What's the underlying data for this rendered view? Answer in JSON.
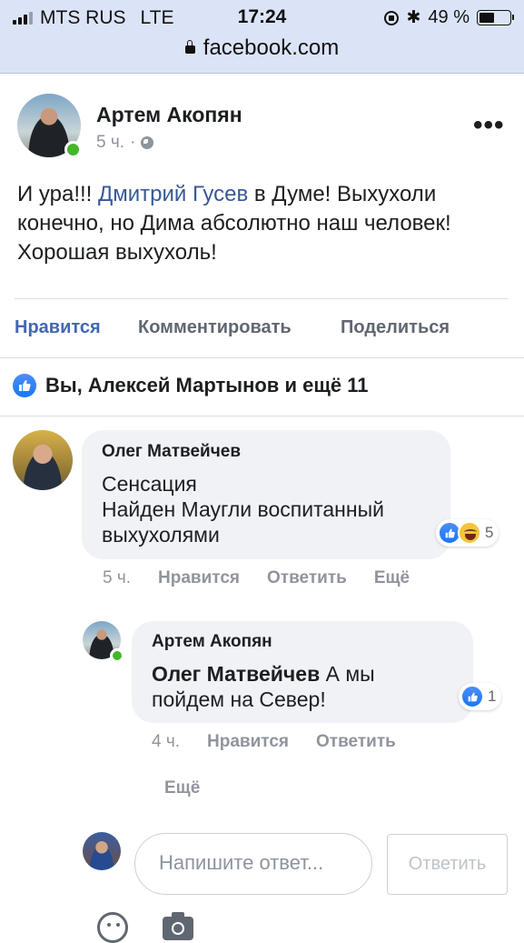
{
  "status_bar": {
    "carrier": "MTS RUS",
    "network": "LTE",
    "time": "17:24",
    "battery": "49 %",
    "battery_level": 0.49
  },
  "browser": {
    "url": "facebook.com"
  },
  "post": {
    "author": "Артем Акопян",
    "time": "5 ч.",
    "separator": "·",
    "text_before": "И ура!!! ",
    "mention": "Дмитрий Гусев",
    "text_after": " в Думе! Выхухоли конечно, но Дима абсолютно наш человек! Хорошая выхухоль!",
    "actions": {
      "like": "Нравится",
      "comment": "Комментировать",
      "share": "Поделиться"
    },
    "likes_summary": "Вы, Алексей Мартынов и ещё 11"
  },
  "comments": [
    {
      "author": "Олег Матвейчев",
      "line1": "Сенсация",
      "line2": "Найден Маугли воспитанный",
      "line3": "выхухолями",
      "reactions_count": "5",
      "time": "5 ч.",
      "like": "Нравится",
      "reply": "Ответить",
      "more": "Ещё"
    }
  ],
  "reply": {
    "author": "Артем Акопян",
    "mention": "Олег Матвейчев",
    "text_line1": " А мы",
    "text_line2": "пойдем на Север!",
    "reactions_count": "1",
    "time": "4 ч.",
    "like": "Нравится",
    "reply": "Ответить",
    "more": "Ещё"
  },
  "composer": {
    "placeholder": "Напишите ответ...",
    "submit": "Ответить"
  }
}
